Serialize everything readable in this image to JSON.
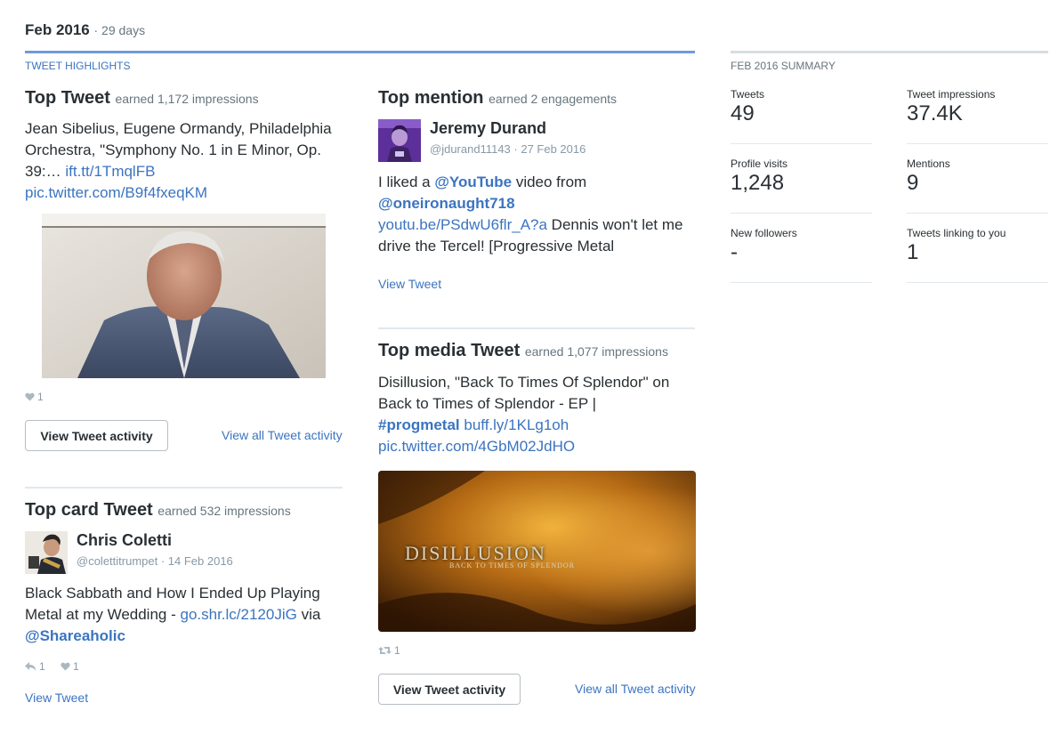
{
  "header": {
    "month": "Feb 2016",
    "days": "· 29 days"
  },
  "highlights": {
    "label": "TWEET HIGHLIGHTS",
    "top_tweet": {
      "title": "Top Tweet",
      "earned": "earned 1,172 impressions",
      "text1": "Jean Sibelius, Eugene Ormandy, Philadelphia Orchestra, \"Symphony No. 1 in E Minor, Op. 39:… ",
      "link1": "ift.tt/1TmqlFB",
      "link2": "pic.twitter.com/B9f4fxeqKM",
      "likes": "1",
      "button": "View Tweet activity",
      "view_all": "View all Tweet activity"
    },
    "top_card": {
      "title": "Top card Tweet",
      "earned": "earned 532 impressions",
      "author": "Chris Coletti",
      "handle": "@colettitrumpet · 14 Feb 2016",
      "text1": "Black Sabbath and How I Ended Up Playing Metal at my Wedding - ",
      "link1": "go.shr.lc/2120JiG",
      "text2": " via ",
      "mention": "@Shareaholic",
      "replies": "1",
      "likes": "1",
      "view_tweet": "View Tweet"
    },
    "top_mention": {
      "title": "Top mention",
      "earned": "earned 2 engagements",
      "author": "Jeremy Durand",
      "handle": "@jdurand11143 · 27 Feb 2016",
      "text1": "I liked a ",
      "mention1": "@YouTube",
      "text2": " video from ",
      "mention2": "@oneironaught718",
      "link1": "youtu.be/PSdwU6flr_A?a",
      "text3": " Dennis won't let me drive the Tercel! [Progressive Metal",
      "view_tweet": "View Tweet"
    },
    "top_media": {
      "title": "Top media Tweet",
      "earned": "earned 1,077 impressions",
      "text1": "Disillusion, \"Back To Times Of Splendor\" on Back to Times of Splendor - EP | ",
      "hashtag": "#progmetal",
      "link1": "buff.ly/1KLg1oh",
      "link2": "pic.twitter.com/4GbM02JdHO",
      "image_title": "DISILLUSION",
      "image_subtitle": "BACK TO TIMES OF SPLENDOR",
      "retweets": "1",
      "button": "View Tweet activity",
      "view_all": "View all Tweet activity"
    }
  },
  "summary": {
    "label": "FEB 2016 SUMMARY",
    "stats": [
      {
        "label": "Tweets",
        "value": "49"
      },
      {
        "label": "Tweet impressions",
        "value": "37.4K"
      },
      {
        "label": "Profile visits",
        "value": "1,248"
      },
      {
        "label": "Mentions",
        "value": "9"
      },
      {
        "label": "New followers",
        "value": "-"
      },
      {
        "label": "Tweets linking to you",
        "value": "1"
      }
    ]
  },
  "colors": {
    "link": "#3b74c0",
    "accent_rule": "#6f9bd9",
    "muted": "#66757f"
  },
  "icons": [
    "heart-icon",
    "reply-icon",
    "retweet-icon"
  ]
}
